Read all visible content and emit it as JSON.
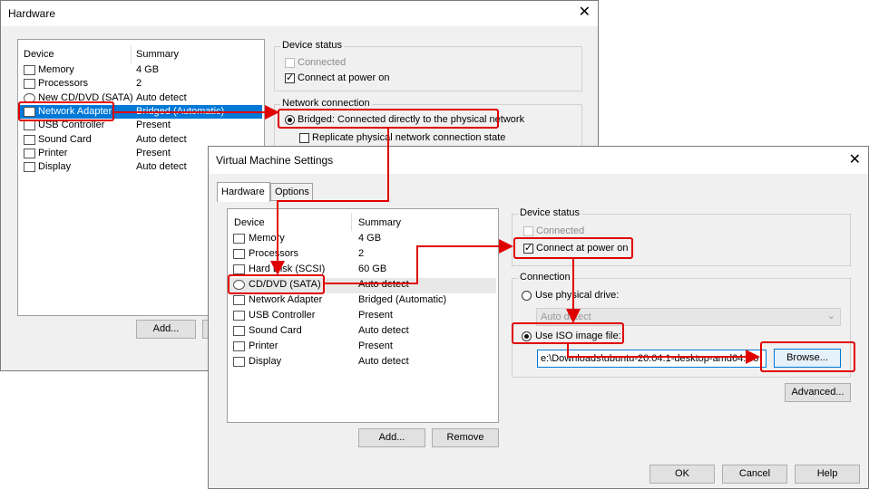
{
  "back_window": {
    "title": "Hardware",
    "device_header": "Device",
    "summary_header": "Summary",
    "devices": [
      {
        "name": "Memory",
        "summary": "4 GB",
        "icon": "memory-icon"
      },
      {
        "name": "Processors",
        "summary": "2",
        "icon": "processor-icon"
      },
      {
        "name": "New CD/DVD (SATA)",
        "summary": "Auto detect",
        "icon": "cd-icon"
      },
      {
        "name": "Network Adapter",
        "summary": "Bridged (Automatic)",
        "icon": "network-icon"
      },
      {
        "name": "USB Controller",
        "summary": "Present",
        "icon": "usb-icon"
      },
      {
        "name": "Sound Card",
        "summary": "Auto detect",
        "icon": "sound-icon"
      },
      {
        "name": "Printer",
        "summary": "Present",
        "icon": "printer-icon"
      },
      {
        "name": "Display",
        "summary": "Auto detect",
        "icon": "display-icon"
      }
    ],
    "device_status_label": "Device status",
    "connected_label": "Connected",
    "connect_power_label": "Connect at power on",
    "network_connection_label": "Network connection",
    "bridged_label": "Bridged: Connected directly to the physical network",
    "replicate_label": "Replicate physical network connection state",
    "add_button": "Add..."
  },
  "front_window": {
    "title": "Virtual Machine Settings",
    "tabs": [
      "Hardware",
      "Options"
    ],
    "device_header": "Device",
    "summary_header": "Summary",
    "devices": [
      {
        "name": "Memory",
        "summary": "4 GB",
        "icon": "memory-icon"
      },
      {
        "name": "Processors",
        "summary": "2",
        "icon": "processor-icon"
      },
      {
        "name": "Hard Disk (SCSI)",
        "summary": "60 GB",
        "icon": "harddisk-icon"
      },
      {
        "name": "CD/DVD (SATA)",
        "summary": "Auto detect",
        "icon": "cd-icon"
      },
      {
        "name": "Network Adapter",
        "summary": "Bridged (Automatic)",
        "icon": "network-icon"
      },
      {
        "name": "USB Controller",
        "summary": "Present",
        "icon": "usb-icon"
      },
      {
        "name": "Sound Card",
        "summary": "Auto detect",
        "icon": "sound-icon"
      },
      {
        "name": "Printer",
        "summary": "Present",
        "icon": "printer-icon"
      },
      {
        "name": "Display",
        "summary": "Auto detect",
        "icon": "display-icon"
      }
    ],
    "device_status_label": "Device status",
    "connected_label": "Connected",
    "connect_power_label": "Connect at power on",
    "connection_label": "Connection",
    "physical_drive_label": "Use physical drive:",
    "physical_drive_value": "Auto detect",
    "iso_label": "Use ISO image file:",
    "iso_path": "e:\\Downloads\\ubuntu-20.04.1-desktop-amd64.iso",
    "browse_button": "Browse...",
    "advanced_button": "Advanced...",
    "add_button": "Add...",
    "remove_button": "Remove",
    "ok_button": "OK",
    "cancel_button": "Cancel",
    "help_button": "Help"
  },
  "colors": {
    "highlight": "#e00000",
    "selection": "#0078d7"
  }
}
